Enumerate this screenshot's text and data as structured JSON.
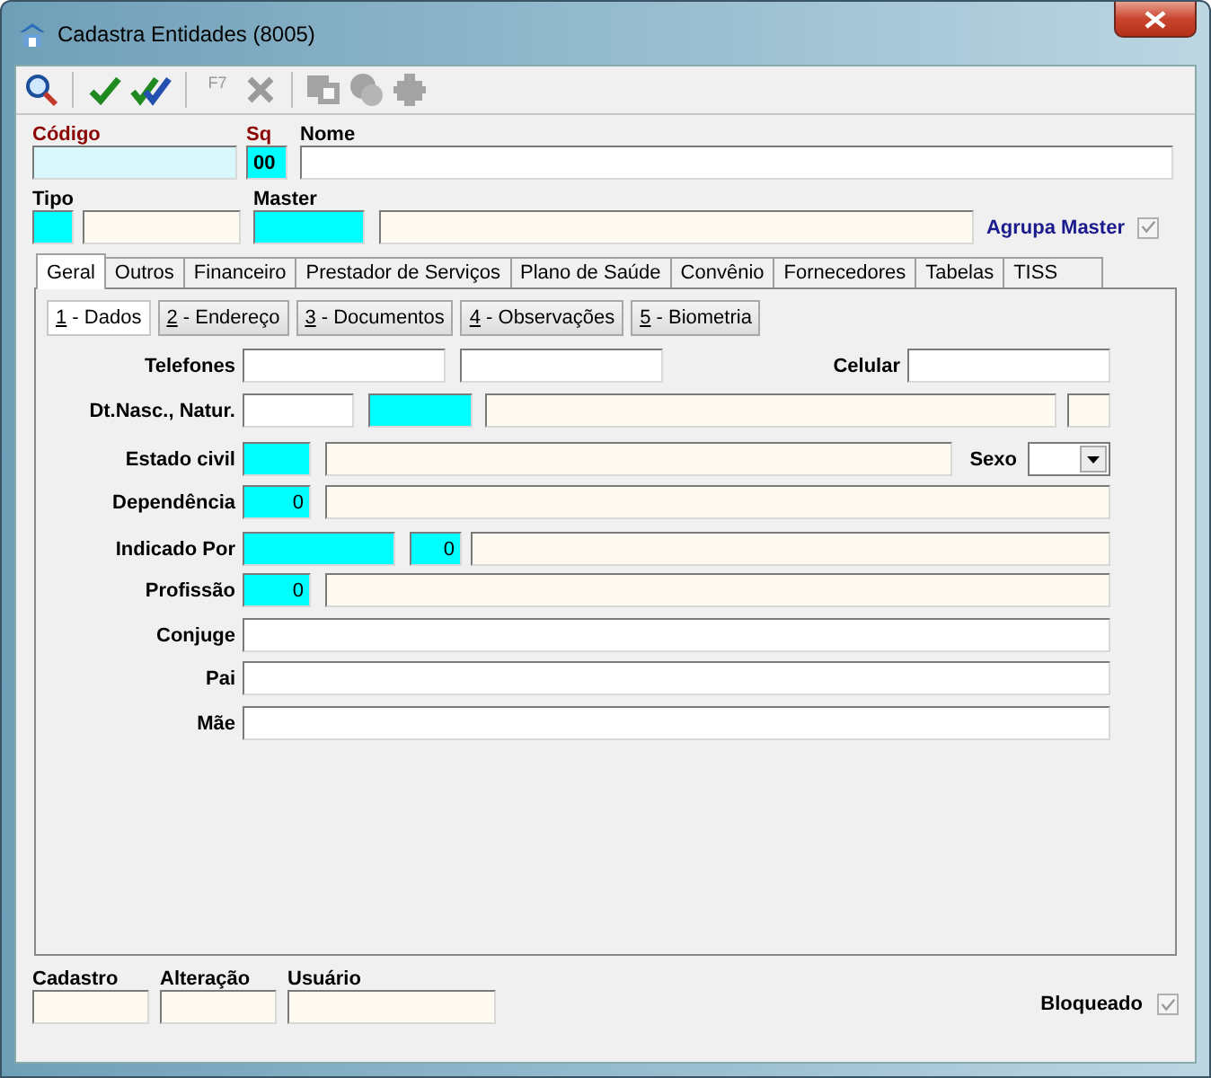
{
  "window": {
    "title": "Cadastra Entidades (8005)"
  },
  "toolbar": [
    {
      "kind": "search",
      "disabled": false
    },
    {
      "kind": "separator"
    },
    {
      "kind": "check",
      "disabled": false
    },
    {
      "kind": "double-check",
      "disabled": false
    },
    {
      "kind": "separator"
    },
    {
      "kind": "text",
      "label": "F7",
      "disabled": true
    },
    {
      "kind": "cancel",
      "disabled": true
    },
    {
      "kind": "separator"
    },
    {
      "kind": "windows",
      "disabled": true
    },
    {
      "kind": "blob",
      "disabled": true
    },
    {
      "kind": "puzzle",
      "disabled": true
    }
  ],
  "header": {
    "codigo": {
      "label": "Código",
      "field": {
        "kind": "key"
      }
    },
    "sq": {
      "label": "Sq",
      "field": {
        "kind": "required",
        "value": "00"
      }
    },
    "nome": {
      "label": "Nome",
      "field": {
        "kind": "input"
      }
    },
    "tipo": {
      "label": "Tipo",
      "fields": [
        {
          "kind": "required"
        },
        {
          "kind": "readonly"
        }
      ]
    },
    "master": {
      "label": "Master",
      "fields": [
        {
          "kind": "required"
        },
        {
          "kind": "readonly"
        }
      ]
    },
    "agrupa_master": {
      "label": "Agrupa Master",
      "checked": true,
      "disabled": true
    }
  },
  "tabs": [
    {
      "label": "Geral",
      "selected": true
    },
    {
      "label": "Outros",
      "selected": false
    },
    {
      "label": "Financeiro",
      "selected": false
    },
    {
      "label": "Prestador de Serviços",
      "selected": false
    },
    {
      "label": "Plano de Saúde",
      "selected": false
    },
    {
      "label": "Convênio",
      "selected": false
    },
    {
      "label": "Fornecedores",
      "selected": false
    },
    {
      "label": "Tabelas",
      "selected": false
    },
    {
      "label": "TISS",
      "selected": false
    }
  ],
  "subtabs": [
    {
      "label": "1 - Dados",
      "selected": true
    },
    {
      "label": "2 - Endereço",
      "selected": false
    },
    {
      "label": "3 - Documentos",
      "selected": false
    },
    {
      "label": "4 - Observações",
      "selected": false
    },
    {
      "label": "5 - Biometria",
      "selected": false
    }
  ],
  "form_rows": [
    {
      "label": "Telefones",
      "fields": [
        {
          "kind": "input"
        },
        {
          "kind": "input"
        }
      ],
      "side": {
        "label": "Celular",
        "field": {
          "kind": "input"
        }
      }
    },
    {
      "label": "Dt.Nasc., Natur.",
      "fields": [
        {
          "kind": "input"
        },
        {
          "kind": "required"
        },
        {
          "kind": "readonly"
        },
        {
          "kind": "readonly"
        }
      ]
    },
    {
      "label": "Estado civil",
      "fields": [
        {
          "kind": "required"
        },
        {
          "kind": "readonly"
        }
      ],
      "side": {
        "label": "Sexo",
        "field": {
          "kind": "combo"
        }
      }
    },
    {
      "label": "Dependência",
      "fields": [
        {
          "kind": "required",
          "value": "0"
        },
        {
          "kind": "readonly"
        }
      ]
    },
    {
      "label": "Indicado Por",
      "fields": [
        {
          "kind": "required"
        },
        {
          "kind": "required",
          "value": "0"
        },
        {
          "kind": "readonly"
        }
      ]
    },
    {
      "label": "Profissão",
      "fields": [
        {
          "kind": "required",
          "value": "0"
        },
        {
          "kind": "readonly"
        }
      ]
    },
    {
      "label": "Conjuge",
      "fields": [
        {
          "kind": "input"
        }
      ]
    },
    {
      "label": "Pai",
      "fields": [
        {
          "kind": "input"
        }
      ]
    },
    {
      "label": "Mãe",
      "fields": [
        {
          "kind": "input"
        }
      ]
    }
  ],
  "footer": {
    "fields": [
      {
        "label": "Cadastro",
        "field": {
          "kind": "readonly"
        }
      },
      {
        "label": "Alteração",
        "field": {
          "kind": "readonly"
        }
      },
      {
        "label": "Usuário",
        "field": {
          "kind": "readonly"
        }
      }
    ],
    "bloqueado": {
      "label": "Bloqueado",
      "checked": true,
      "disabled": true
    }
  }
}
